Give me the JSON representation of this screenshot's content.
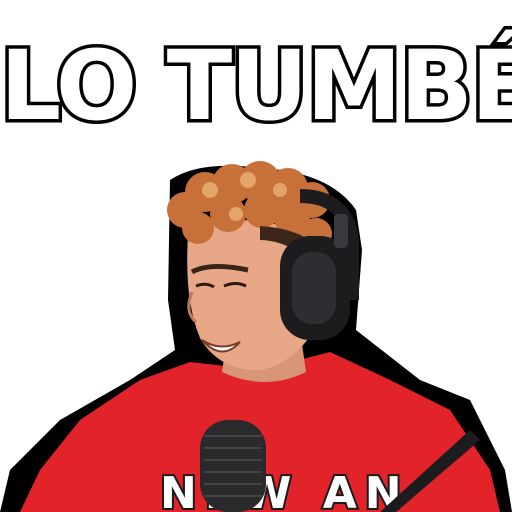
{
  "caption": {
    "text": "LO TUMBÉ"
  },
  "shirt": {
    "print_text": "NEW AN"
  },
  "colors": {
    "caption_fill": "#ffffff",
    "caption_outline": "#000000",
    "shirt": "#e3232a",
    "hair": "#c8703a",
    "skin": "#e8a888",
    "headset": "#1c1c1e",
    "microphone": "#2a2a2c",
    "outline": "#000000"
  }
}
